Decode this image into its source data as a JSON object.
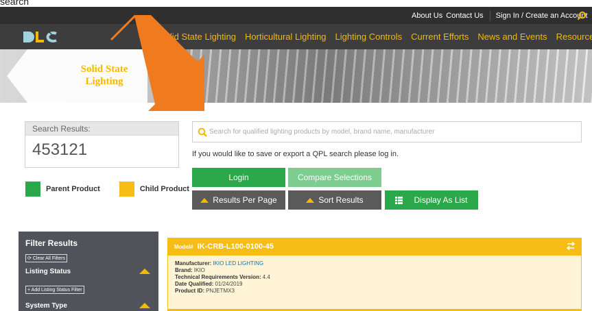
{
  "caption": "search",
  "utility": {
    "about": "About Us",
    "contact": "Contact Us",
    "signin": "Sign In / Create an Account"
  },
  "nav": {
    "logo_alt": "DLC",
    "items": [
      "Solid State Lighting",
      "Horticultural Lighting",
      "Lighting Controls",
      "Current Efforts",
      "News and Events",
      "Resources"
    ]
  },
  "hero": {
    "title_line1": "Solid State",
    "title_line2": "Lighting"
  },
  "results": {
    "label": "Search Results:",
    "count": "453121"
  },
  "legend": {
    "parent": "Parent Product",
    "child": "Child Product"
  },
  "search": {
    "placeholder": "Search for qualified lighting products by model, brand name, manufacturer",
    "value": ""
  },
  "login_note": "If you would like to save or export a QPL search please log in.",
  "buttons": {
    "login": "Login",
    "compare": "Compare Selections",
    "per_page": "Results Per Page",
    "sort": "Sort Results",
    "display_list": "Display As List"
  },
  "filters": {
    "title": "Filter Results",
    "clear": "Clear All Filters",
    "listing_status": "Listing Status",
    "add_listing": "+ Add Listing Status Filter",
    "system_type": "System Type"
  },
  "product": {
    "model_label": "Model#",
    "model": "IK-CRB-L100-0100-45",
    "manufacturer_label": "Manufacturer:",
    "manufacturer": "IKIO LED LIGHTING",
    "brand_label": "Brand:",
    "brand": "IKIO",
    "tech_label": "Technical Requirements Version:",
    "tech": "4.4",
    "date_label": "Date Qualified:",
    "date": "01/24/2019",
    "pid_label": "Product ID:",
    "pid": "PNJETMX3"
  },
  "colors": {
    "accent_yellow": "#f6b800",
    "green": "#2aa84a",
    "light_green": "#7ccd8f",
    "dark_gray": "#3d3d3d",
    "arrow_orange": "#f07b1f"
  }
}
